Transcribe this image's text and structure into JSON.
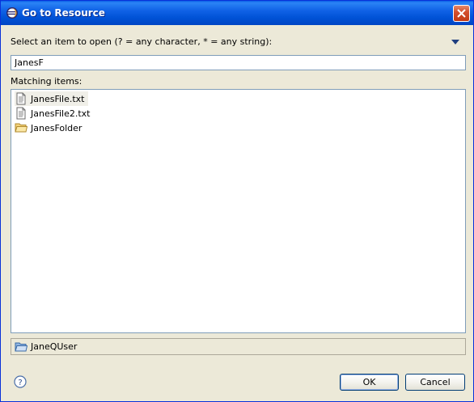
{
  "window": {
    "title": "Go to Resource"
  },
  "prompt": "Select an item to open (? = any character, * = any string):",
  "search": {
    "value": "JanesF"
  },
  "matching_label": "Matching items:",
  "items": [
    {
      "label": "JanesFile.txt",
      "icon": "text-file-icon",
      "selected": true
    },
    {
      "label": "JanesFile2.txt",
      "icon": "text-file-icon",
      "selected": false
    },
    {
      "label": "JanesFolder",
      "icon": "folder-icon",
      "selected": false
    }
  ],
  "status": {
    "label": "JaneQUser",
    "icon": "project-folder-icon"
  },
  "buttons": {
    "ok": "OK",
    "cancel": "Cancel"
  }
}
